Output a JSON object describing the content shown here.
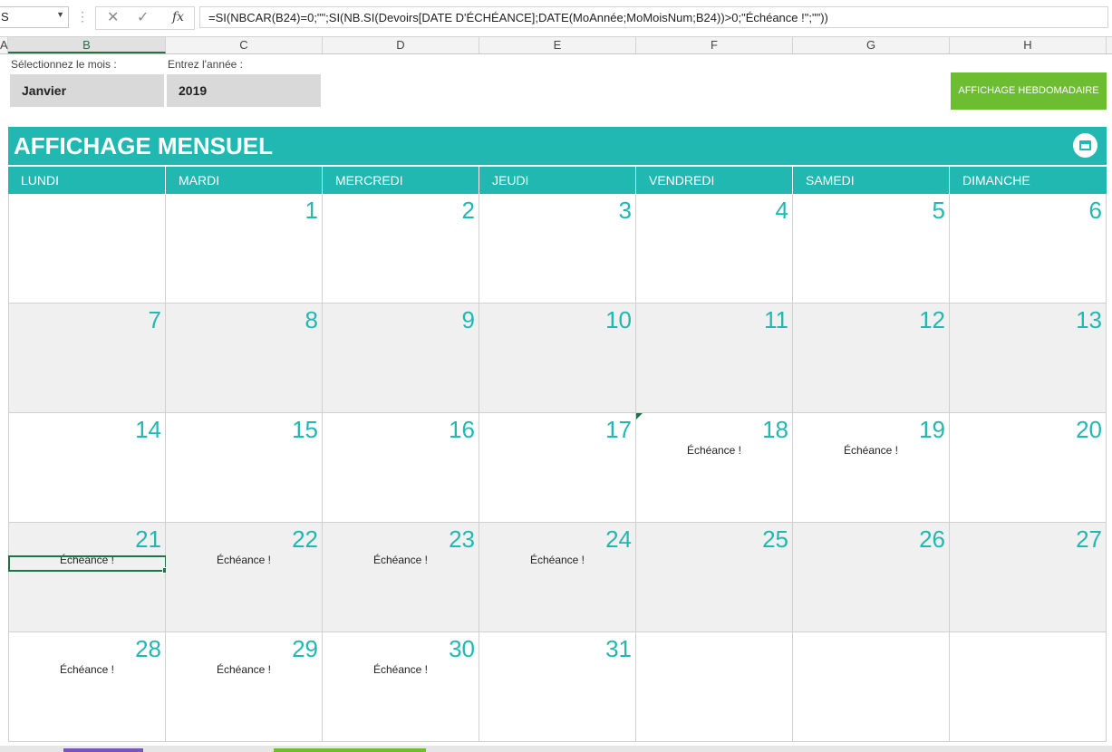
{
  "formula_bar": {
    "name_box": "S",
    "cancel_icon": "✕",
    "enter_icon": "✓",
    "fx_label": "fx",
    "formula": "=SI(NBCAR(B24)=0;\"\";SI(NB.SI(Devoirs[DATE D'ÉCHÉANCE];DATE(MoAnnée;MoMoisNum;B24))>0;\"Échéance !\";\"\"))"
  },
  "column_headers": [
    "A",
    "B",
    "C",
    "D",
    "E",
    "F",
    "G",
    "H"
  ],
  "active_column": "B",
  "controls": {
    "month_label": "Sélectionnez le mois :",
    "month_value": "Janvier",
    "year_label": "Entrez l'année :",
    "year_value": "2019",
    "weekly_button": "AFFICHAGE HEBDOMADAIRE"
  },
  "calendar": {
    "title": "AFFICHAGE MENSUEL",
    "icon": "calendar-icon",
    "weekdays": [
      "LUNDI",
      "MARDI",
      "MERCREDI",
      "JEUDI",
      "VENDREDI",
      "SAMEDI",
      "DIMANCHE"
    ],
    "due_label": "Échéance !",
    "weeks": [
      [
        "",
        "1",
        "2",
        "3",
        "4",
        "5",
        "6"
      ],
      [
        "7",
        "8",
        "9",
        "10",
        "11",
        "12",
        "13"
      ],
      [
        "14",
        "15",
        "16",
        "17",
        "18",
        "19",
        "20"
      ],
      [
        "21",
        "22",
        "23",
        "24",
        "25",
        "26",
        "27"
      ],
      [
        "28",
        "29",
        "30",
        "31",
        "",
        "",
        ""
      ]
    ],
    "due_days": [
      "18",
      "19",
      "21",
      "22",
      "23",
      "24",
      "28",
      "29",
      "30"
    ],
    "due_texts": {
      "18": "Échéance  !",
      "19": "Échéance !",
      "21": "Échéance !",
      "22": "Échéance !",
      "23": "Échéance !",
      "24": "Échéance !",
      "28": "Échéance !",
      "29": "Échéance !",
      "30": "Échéance !"
    }
  },
  "colors": {
    "accent": "#20b8b0",
    "button_green": "#6cbd2f",
    "selection_green": "#217346",
    "row_shade": "#f0f0f0"
  }
}
